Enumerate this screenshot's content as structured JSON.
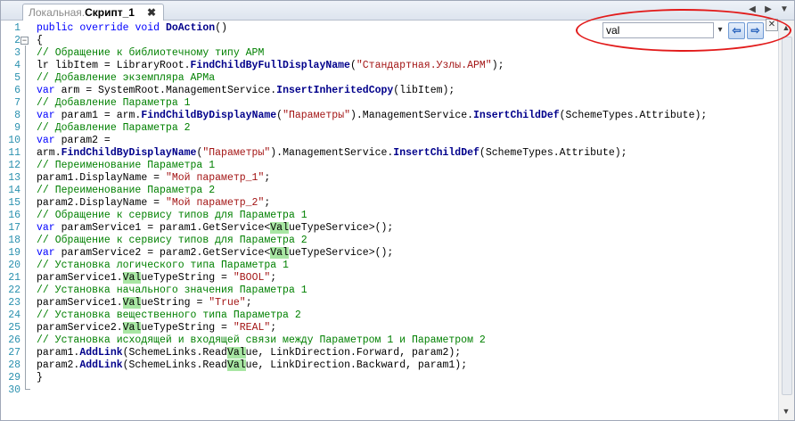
{
  "tab": {
    "prefix": "Локальная.",
    "name": "Скрипт_1",
    "close": "✖"
  },
  "tabbar_buttons": [
    "◀",
    "▶",
    "▼"
  ],
  "search": {
    "value": "val",
    "dropdown": "▾",
    "prev": "⇦",
    "next": "⇨",
    "close": "✕"
  },
  "scroll": {
    "up": "▲",
    "down": "▼"
  },
  "annotation": {
    "color": "#e21b1b",
    "shape": "ellipse"
  },
  "colors": {
    "keyword": "#0000ff",
    "comment": "#008000",
    "string": "#a31515",
    "match": "#a8e6a3",
    "current_match": "#3b8fe6",
    "line_number": "#2b91af"
  },
  "lines": [
    "public override void DoAction()",
    "{",
    "// Обращение к библиотечному типу АРМ",
    "lr libItem = LibraryRoot.FindChildByFullDisplayName(\"Стандартная.Узлы.АРМ\");",
    "// Добавление экземпляра АРМа",
    "var arm = SystemRoot.ManagementService.InsertInheritedCopy(libItem);",
    "// Добавление Параметра 1",
    "var param1 = arm.FindChildByDisplayName(\"Параметры\").ManagementService.InsertChildDef(SchemeTypes.Attribute);",
    "// Добавление Параметра 2",
    "var param2 =",
    "arm.FindChildByDisplayName(\"Параметры\").ManagementService.InsertChildDef(SchemeTypes.Attribute);",
    "// Переименование Параметра 1",
    "param1.DisplayName = \"Мой параметр_1\";",
    "// Переименование Параметра 2",
    "param2.DisplayName = \"Мой параметр_2\";",
    "// Обращение к сервису типов для Параметра 1",
    "var paramService1 = param1.GetService<ValueTypeService>();",
    "// Обращение к сервису типов для Параметра 2",
    "var paramService2 = param2.GetService<ValueTypeService>();",
    "// Установка логического типа Параметра 1",
    "paramService1.ValueTypeString = \"BOOL\";",
    "// Установка начального значения Параметра 1",
    "paramService1.ValueString = \"True\";",
    "// Установка вещественного типа Параметра 2",
    "paramService2.ValueTypeString = \"REAL\";",
    "// Установка исходящей и входящей связи между Параметром 1 и Параметром 2",
    "param1.AddLink(SchemeLinks.ReadValue, LinkDirection.Forward, param2);",
    "param2.AddLink(SchemeLinks.ReadValue, LinkDirection.Backward, param1);",
    "}",
    ""
  ]
}
